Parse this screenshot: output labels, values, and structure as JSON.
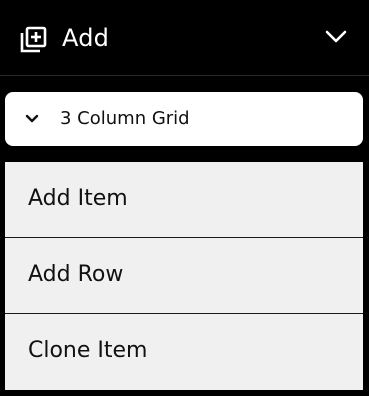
{
  "header": {
    "title": "Add",
    "add_icon": "add-box-icon",
    "collapse_icon": "chevron-down-icon"
  },
  "grid_select": {
    "selected": "3 Column Grid",
    "icon": "chevron-down-icon"
  },
  "menu": {
    "items": [
      {
        "label": "Add Item"
      },
      {
        "label": "Add Row"
      },
      {
        "label": "Clone Item"
      }
    ]
  },
  "colors": {
    "header_bg": "#000000",
    "select_bg": "#ffffff",
    "menu_bg": "#f0f0f0",
    "divider": "#1a1a1a"
  }
}
